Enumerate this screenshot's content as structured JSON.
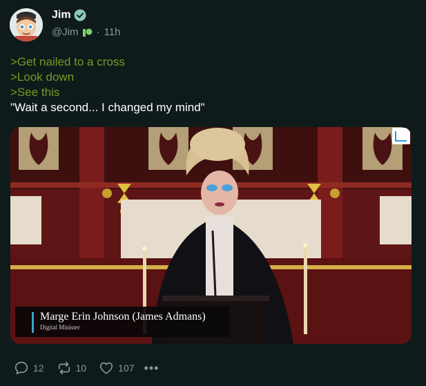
{
  "author": {
    "name": "Jim",
    "handle": "@Jim",
    "separator": "·",
    "time": "11h",
    "verified": true,
    "verified_color": "#8ec9b6"
  },
  "post": {
    "lines": [
      ">Get nailed to a cross",
      ">Look down",
      ">See this"
    ],
    "quote": "\"Wait a second... I changed my mind\"",
    "greentext_color": "#789922"
  },
  "media": {
    "caption_name": "Marge Erin Johnson (James Admans)",
    "caption_title": "Digital Minister"
  },
  "actions": {
    "replies": "12",
    "reposts": "10",
    "likes": "107",
    "more": "•••"
  }
}
